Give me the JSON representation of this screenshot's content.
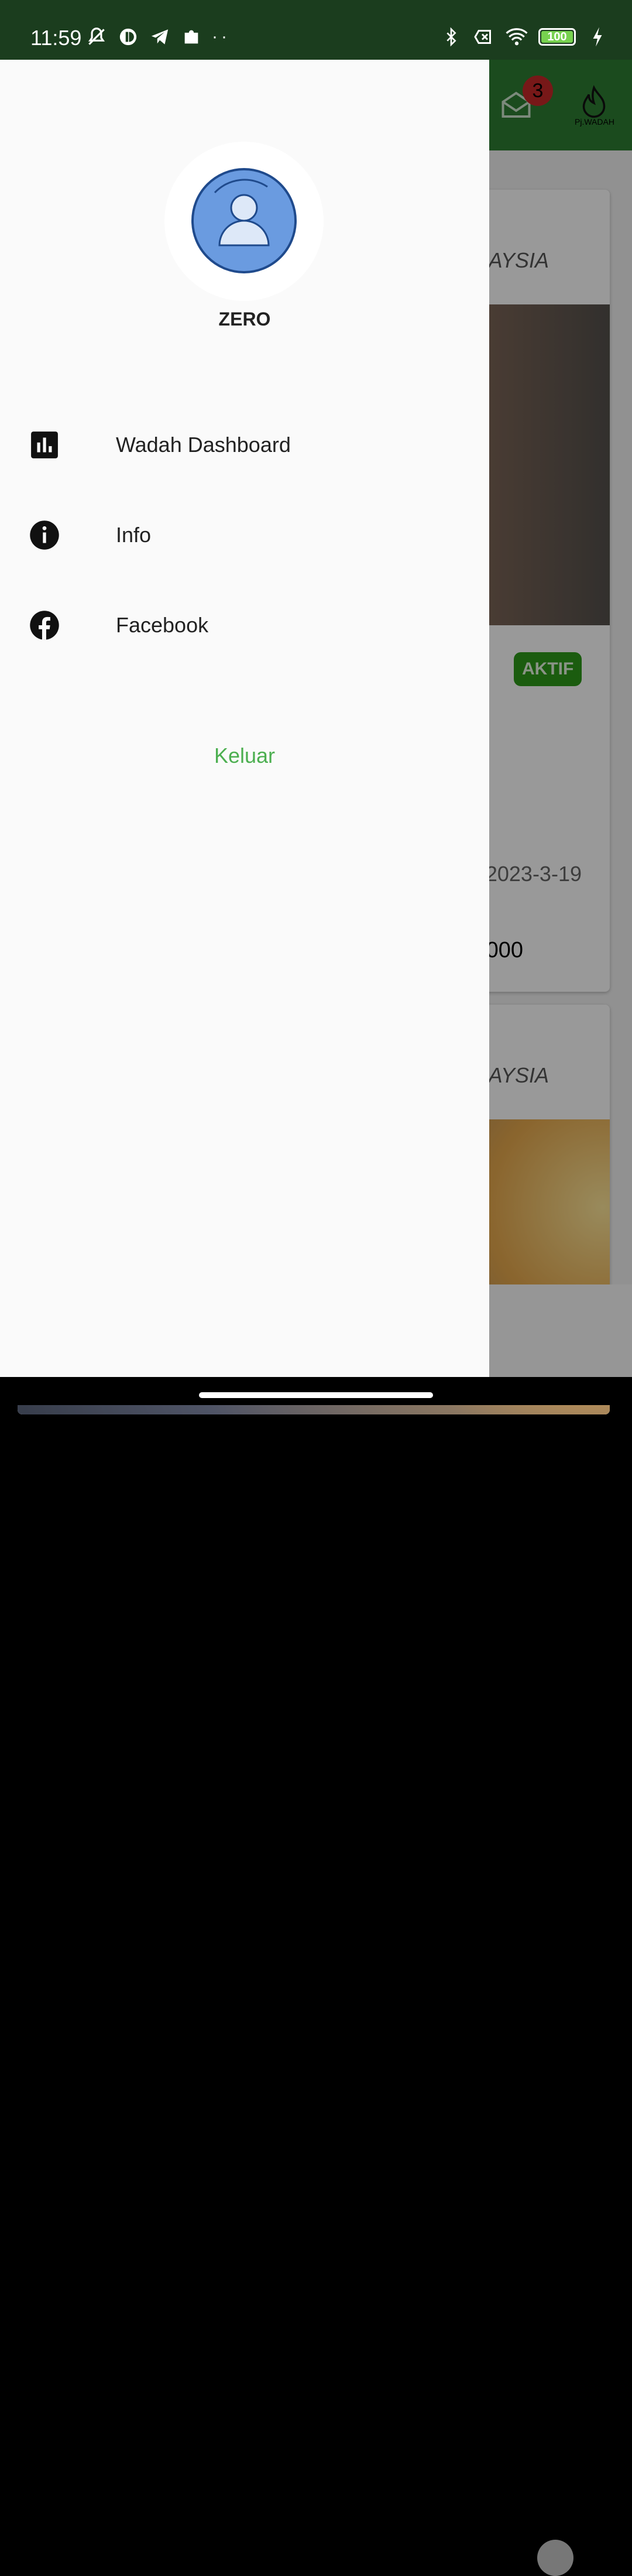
{
  "status_bar": {
    "time": "11:59",
    "left_icons": [
      "mute-vibrate-icon",
      "app-icon",
      "telegram-icon",
      "puzzle-icon"
    ],
    "dots": "··",
    "right_icons": [
      "bluetooth-icon",
      "no-sim-icon",
      "wifi-icon"
    ],
    "battery_level": "100",
    "charging": true
  },
  "background_app": {
    "notification_count": "3",
    "logo_text": "Pj.WADAH",
    "cards": [
      {
        "country": "AYSIA",
        "status": "AKTIF",
        "date": "2023-3-19",
        "amount": "000"
      },
      {
        "country": "AYSIA"
      }
    ]
  },
  "drawer": {
    "user_name": "ZERO",
    "menu": [
      {
        "label": "Wadah Dashboard",
        "icon": "bar-chart-icon"
      },
      {
        "label": "Info",
        "icon": "info-icon"
      },
      {
        "label": "Facebook",
        "icon": "facebook-icon"
      }
    ],
    "logout_label": "Keluar"
  },
  "colors": {
    "status_bar": "#1b3d1e",
    "app_bar": "#2e7d32",
    "drawer_bg": "#fafafa",
    "logout": "#4caf50",
    "status_active": "#2e9a1a",
    "badge": "#c62828",
    "avatar_blue": "#6a9be0"
  }
}
